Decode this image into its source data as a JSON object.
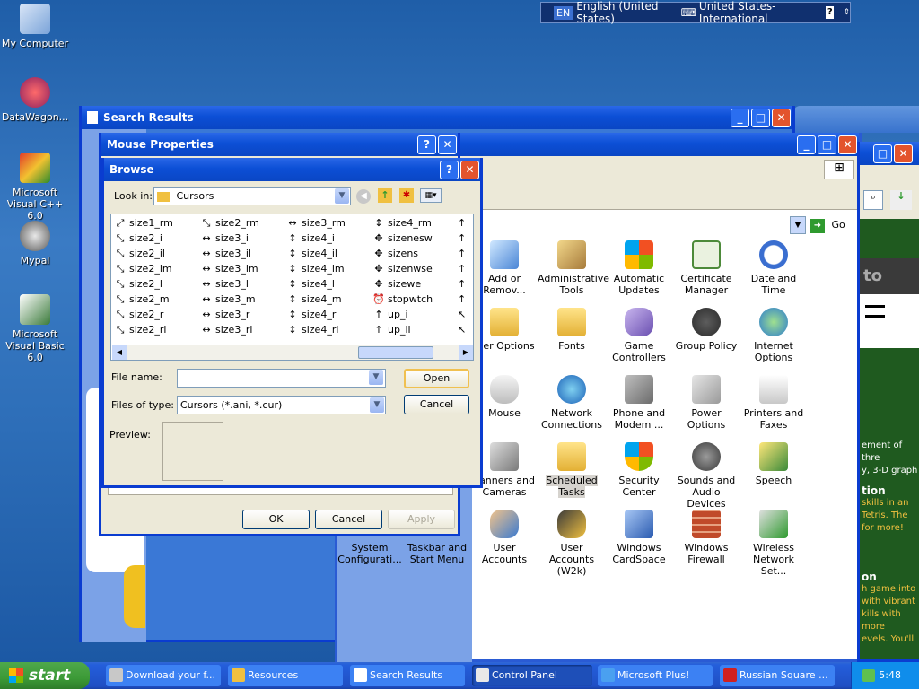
{
  "desktop": {
    "icons": [
      {
        "label": "My Computer"
      },
      {
        "label": "DataWagon..."
      },
      {
        "label": "Microsoft Visual C++ 6.0"
      },
      {
        "label": "Mypal"
      },
      {
        "label": "Microsoft Visual Basic 6.0"
      }
    ]
  },
  "language_bar": {
    "lang_code": "EN",
    "language": "English (United States)",
    "keyboard": "United States-International",
    "help": "?"
  },
  "search_results_window": {
    "title": "Search Results"
  },
  "mouse_properties": {
    "title": "Mouse Properties",
    "ok": "OK",
    "cancel": "Cancel",
    "apply": "Apply"
  },
  "browse_dialog": {
    "title": "Browse",
    "look_in_label": "Look in:",
    "look_in_value": "Cursors",
    "file_name_label": "File name:",
    "file_name_value": "",
    "files_of_type_label": "Files of type:",
    "files_of_type_value": "Cursors (*.ani, *.cur)",
    "preview_label": "Preview:",
    "open": "Open",
    "cancel": "Cancel",
    "columns": [
      [
        {
          "glyph": "⤢",
          "name": "size1_rm"
        },
        {
          "glyph": "⤡",
          "name": "size2_i"
        },
        {
          "glyph": "⤡",
          "name": "size2_il"
        },
        {
          "glyph": "⤡",
          "name": "size2_im"
        },
        {
          "glyph": "⤡",
          "name": "size2_l"
        },
        {
          "glyph": "⤡",
          "name": "size2_m"
        },
        {
          "glyph": "⤡",
          "name": "size2_r"
        },
        {
          "glyph": "⤡",
          "name": "size2_rl"
        }
      ],
      [
        {
          "glyph": "⤡",
          "name": "size2_rm"
        },
        {
          "glyph": "↔",
          "name": "size3_i"
        },
        {
          "glyph": "↔",
          "name": "size3_il"
        },
        {
          "glyph": "↔",
          "name": "size3_im"
        },
        {
          "glyph": "↔",
          "name": "size3_l"
        },
        {
          "glyph": "↔",
          "name": "size3_m"
        },
        {
          "glyph": "↔",
          "name": "size3_r"
        },
        {
          "glyph": "↔",
          "name": "size3_rl"
        }
      ],
      [
        {
          "glyph": "↔",
          "name": "size3_rm"
        },
        {
          "glyph": "↕",
          "name": "size4_i"
        },
        {
          "glyph": "↕",
          "name": "size4_il"
        },
        {
          "glyph": "↕",
          "name": "size4_im"
        },
        {
          "glyph": "↕",
          "name": "size4_l"
        },
        {
          "glyph": "↕",
          "name": "size4_m"
        },
        {
          "glyph": "↕",
          "name": "size4_r"
        },
        {
          "glyph": "↕",
          "name": "size4_rl"
        }
      ],
      [
        {
          "glyph": "↕",
          "name": "size4_rm"
        },
        {
          "glyph": "✥",
          "name": "sizenesw"
        },
        {
          "glyph": "✥",
          "name": "sizens"
        },
        {
          "glyph": "✥",
          "name": "sizenwse"
        },
        {
          "glyph": "✥",
          "name": "sizewe"
        },
        {
          "glyph": "⏰",
          "name": "stopwtch"
        },
        {
          "glyph": "↑",
          "name": "up_i"
        },
        {
          "glyph": "↑",
          "name": "up_il"
        }
      ]
    ]
  },
  "control_panel": {
    "go": "Go",
    "items": [
      {
        "label": "Add or Remov..."
      },
      {
        "label": "Administrative Tools"
      },
      {
        "label": "Automatic Updates"
      },
      {
        "label": "Certificate Manager"
      },
      {
        "label": "Date and Time"
      },
      {
        "label": "lder Options"
      },
      {
        "label": "Fonts"
      },
      {
        "label": "Game Controllers"
      },
      {
        "label": "Group Policy"
      },
      {
        "label": "Internet Options"
      },
      {
        "label": "Mouse"
      },
      {
        "label": "Network Connections"
      },
      {
        "label": "Phone and Modem ..."
      },
      {
        "label": "Power Options"
      },
      {
        "label": "Printers and Faxes"
      },
      {
        "label": "canners and Cameras"
      },
      {
        "label": "Scheduled Tasks"
      },
      {
        "label": "Security Center"
      },
      {
        "label": "Sounds and Audio Devices"
      },
      {
        "label": "Speech"
      },
      {
        "label": "System Configurati..."
      },
      {
        "label": "Taskbar and Start Menu"
      },
      {
        "label": "User Accounts"
      },
      {
        "label": "User Accounts (W2k)"
      },
      {
        "label": "Windows CardSpace"
      },
      {
        "label": "Windows Firewall"
      },
      {
        "label": "Wireless Network Set..."
      }
    ]
  },
  "side_window": {
    "lines": [
      "ement of thre",
      "y, 3-D graph",
      "tion",
      "skills in an",
      "Tetris. The",
      "for more!",
      "on",
      "h game into",
      "with vibrant",
      "kills with more",
      "evels. You'll"
    ]
  },
  "taskbar": {
    "start": "start",
    "buttons": [
      {
        "label": "Download your f..."
      },
      {
        "label": "Resources"
      },
      {
        "label": "Search Results"
      },
      {
        "label": "Control Panel"
      },
      {
        "label": "Microsoft Plus!"
      },
      {
        "label": "Russian Square ..."
      }
    ],
    "clock": "5:48"
  }
}
